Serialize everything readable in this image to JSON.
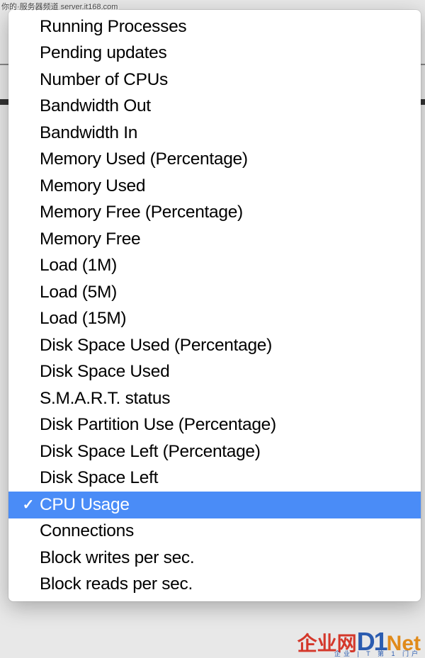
{
  "watermark_top": "你的·服务器频道 server.it168.com",
  "watermark_bottom": {
    "red_text": "企业网",
    "d1": "D1",
    "net": "Net",
    "sub": "企业 | T 第 1 门户"
  },
  "menu": {
    "items": [
      {
        "label": "Running Processes",
        "selected": false
      },
      {
        "label": "Pending updates",
        "selected": false
      },
      {
        "label": "Number of CPUs",
        "selected": false
      },
      {
        "label": "Bandwidth Out",
        "selected": false
      },
      {
        "label": "Bandwidth In",
        "selected": false
      },
      {
        "label": "Memory Used (Percentage)",
        "selected": false
      },
      {
        "label": "Memory Used",
        "selected": false
      },
      {
        "label": "Memory Free (Percentage)",
        "selected": false
      },
      {
        "label": "Memory Free",
        "selected": false
      },
      {
        "label": "Load (1M)",
        "selected": false
      },
      {
        "label": "Load (5M)",
        "selected": false
      },
      {
        "label": "Load (15M)",
        "selected": false
      },
      {
        "label": "Disk Space Used (Percentage)",
        "selected": false
      },
      {
        "label": "Disk Space Used",
        "selected": false
      },
      {
        "label": "S.M.A.R.T. status",
        "selected": false
      },
      {
        "label": "Disk Partition Use (Percentage)",
        "selected": false
      },
      {
        "label": "Disk Space Left (Percentage)",
        "selected": false
      },
      {
        "label": "Disk Space Left",
        "selected": false
      },
      {
        "label": "CPU Usage",
        "selected": true
      },
      {
        "label": "Connections",
        "selected": false
      },
      {
        "label": "Block writes per sec.",
        "selected": false
      },
      {
        "label": "Block reads per sec.",
        "selected": false
      }
    ]
  }
}
